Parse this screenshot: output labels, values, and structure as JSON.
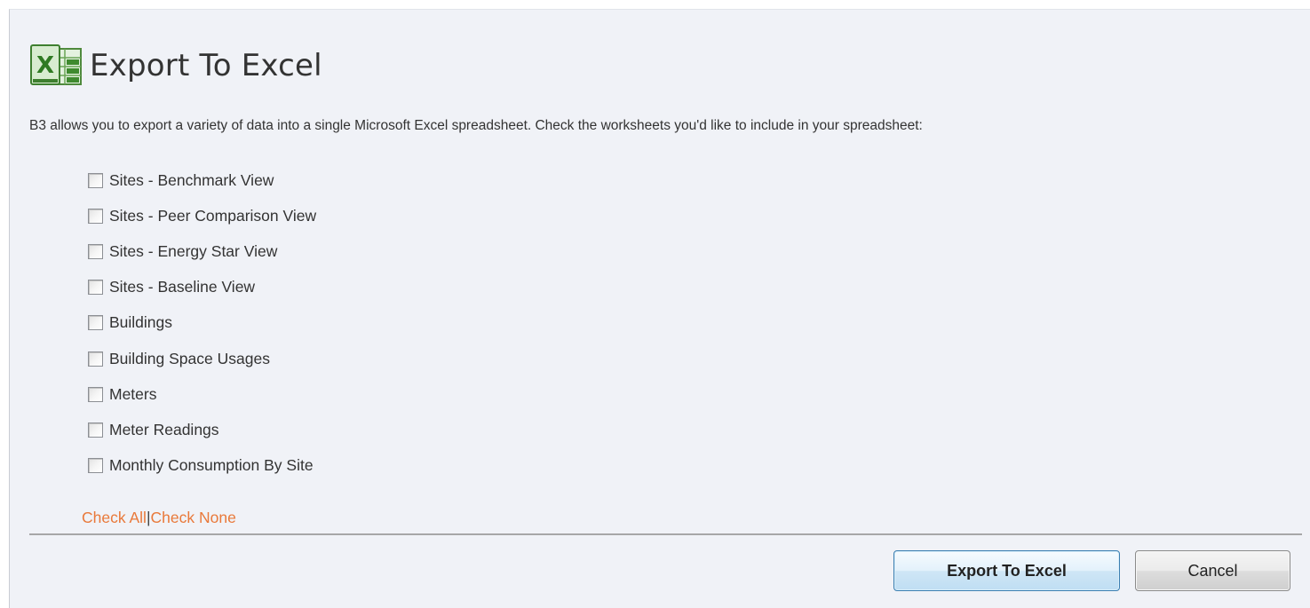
{
  "dialog": {
    "title": "Export To Excel",
    "icon": "excel-icon",
    "icon_letter": "X",
    "description": "B3 allows you to export a variety of data into a single Microsoft Excel spreadsheet. Check the worksheets you'd like to include in your spreadsheet:"
  },
  "worksheets": [
    {
      "label": "Sites - Benchmark View",
      "checked": false
    },
    {
      "label": "Sites - Peer Comparison View",
      "checked": false
    },
    {
      "label": "Sites - Energy Star View",
      "checked": false
    },
    {
      "label": "Sites - Baseline View",
      "checked": false
    },
    {
      "label": "Buildings",
      "checked": false
    },
    {
      "label": "Building Space Usages",
      "checked": false
    },
    {
      "label": "Meters",
      "checked": false
    },
    {
      "label": "Meter Readings",
      "checked": false
    },
    {
      "label": "Monthly Consumption By Site",
      "checked": false
    }
  ],
  "links": {
    "check_all": "Check All",
    "separator": "|",
    "check_none": "Check None"
  },
  "buttons": {
    "export_label": "Export To Excel",
    "cancel_label": "Cancel"
  },
  "colors": {
    "dialog_background": "#f0f2f7",
    "link": "#e9793a",
    "excel_green": "#3a8a2c"
  }
}
